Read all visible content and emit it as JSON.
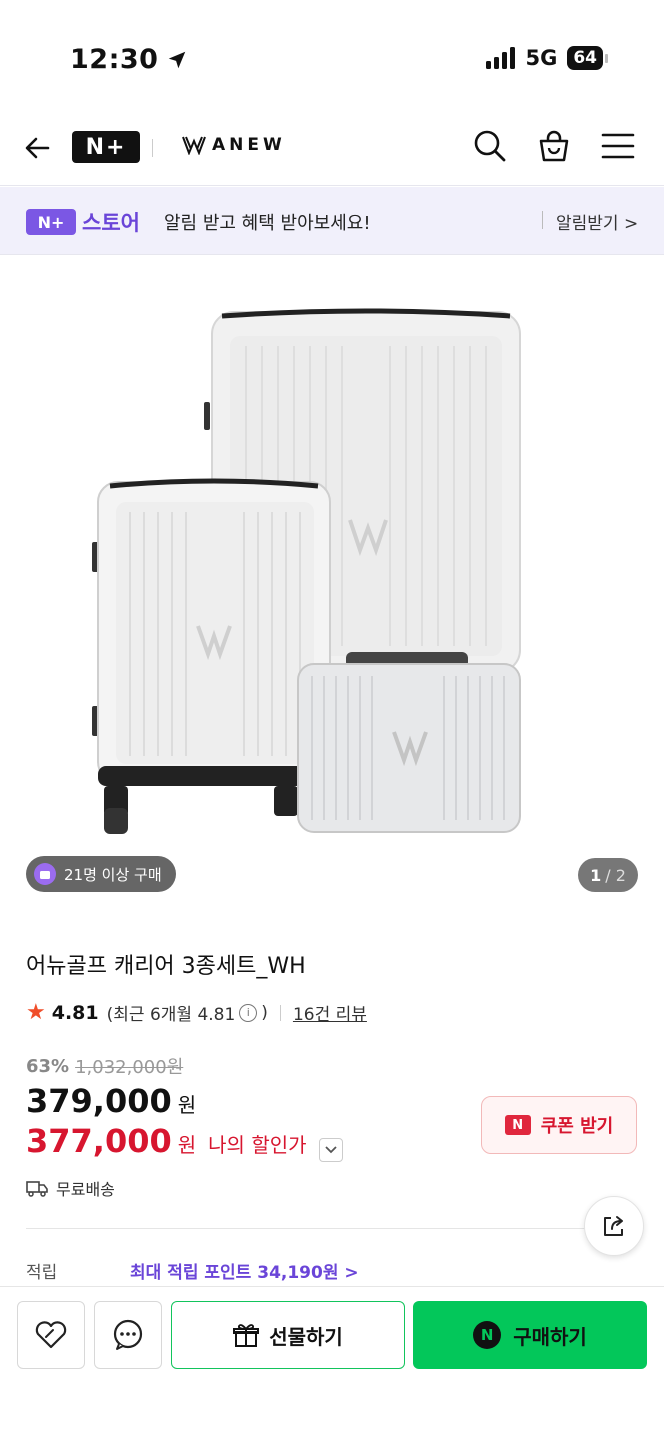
{
  "status": {
    "time": "12:30",
    "network": "5G",
    "battery": "64"
  },
  "nav": {
    "logo": "N+",
    "brand": "ANEW"
  },
  "banner": {
    "logo_box": "N+",
    "logo_text": "스토어",
    "message": "알림 받고 혜택 받아보세요!",
    "action": "알림받기 >"
  },
  "gallery": {
    "badge": "21명 이상 구매",
    "counter_current": "1",
    "counter_total": "/ 2"
  },
  "product": {
    "title": "어뉴골프 캐리어 3종세트_WH",
    "rating": "4.81",
    "rating_recent": "(최근 6개월 4.81",
    "rating_recent_close": ")",
    "reviews": "16건 리뷰",
    "discount": "63%",
    "original_price": "1,032,000원",
    "price": "379,000",
    "price_unit": "원",
    "my_price": "377,000",
    "my_price_unit": "원",
    "my_price_label": "나의 할인가",
    "coupon_button": "쿠폰 받기",
    "coupon_icon": "N",
    "shipping": "무료배송",
    "points_label": "적립",
    "points_value": "최대 적립 포인트 34,190원 >"
  },
  "bottom_bar": {
    "gift": "선물하기",
    "buy": "구매하기",
    "buy_icon": "N"
  },
  "colors": {
    "naver_green": "#03c75a",
    "accent_purple": "#6a45d8",
    "price_red": "#d7162f"
  }
}
